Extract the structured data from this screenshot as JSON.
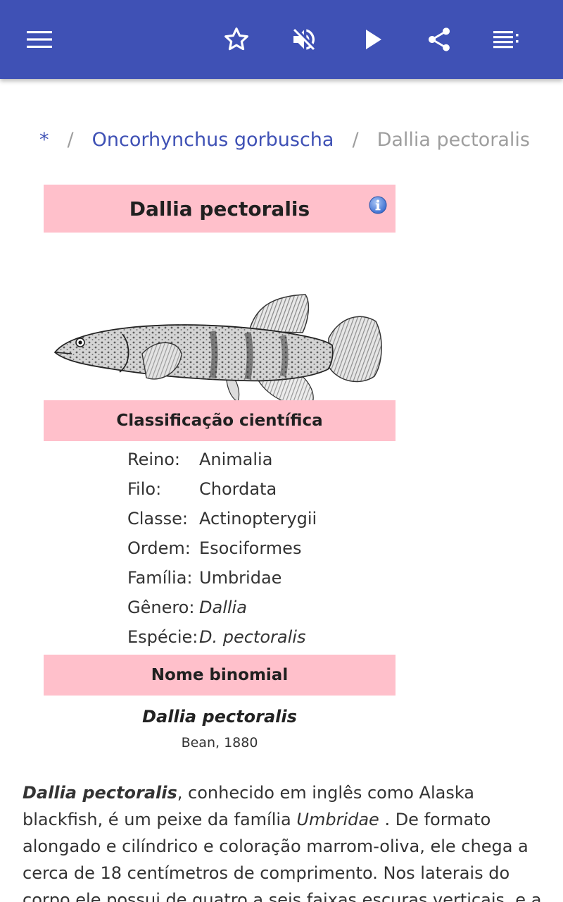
{
  "toolbar": {
    "icons": [
      "menu-icon",
      "star-outline-icon",
      "volume-off-icon",
      "play-icon",
      "share-icon",
      "playlist-icon"
    ],
    "color": "#3f51b5"
  },
  "breadcrumb": {
    "home": "*",
    "separator": "/",
    "parent": "Oncorhynchus gorbuscha",
    "current": "Dallia pectoralis"
  },
  "infobox": {
    "title": "Dallia pectoralis",
    "header_color": "#ffc0cb",
    "classification_heading": "Classificação científica",
    "taxonomy": [
      {
        "key": "Reino:",
        "value": "Animalia",
        "italic": false
      },
      {
        "key": "Filo:",
        "value": "Chordata",
        "italic": false
      },
      {
        "key": "Classe:",
        "value": "Actinopterygii",
        "italic": false
      },
      {
        "key": "Ordem:",
        "value": "Esociformes",
        "italic": false
      },
      {
        "key": "Família:",
        "value": "Umbridae",
        "italic": false
      },
      {
        "key": "Gênero:",
        "value": "Dallia",
        "italic": true
      },
      {
        "key": "Espécie:",
        "value": "D. pectoralis",
        "italic": true
      }
    ],
    "binomial_heading": "Nome binomial",
    "binomial_name": "Dallia pectoralis",
    "binomial_author": "Bean, 1880"
  },
  "article": {
    "lead_bold": "Dallia pectoralis",
    "text1": ", conhecido em inglês como Alaska blackfish, é um peixe da família ",
    "family_italic": "Umbridae",
    "text2": " . De formato alongado e cilíndrico e coloração marrom-oliva, ele chega a cerca de 18 centímetros de comprimento. Nos laterais do corpo ele possui de quatro a seis faixas escuras verticais, e a sua barriga é"
  }
}
